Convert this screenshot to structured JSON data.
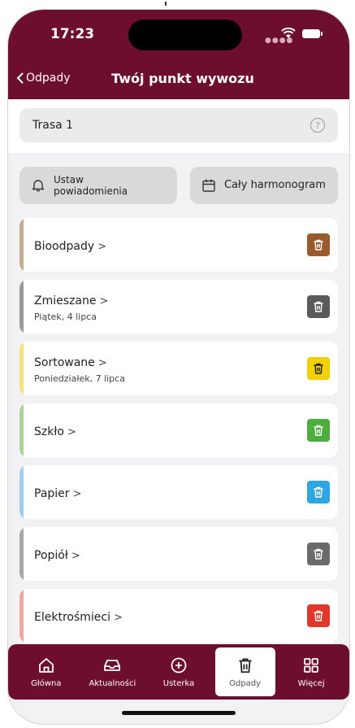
{
  "status": {
    "time": "17:23"
  },
  "nav": {
    "back_label": "Odpady",
    "title": "Twój punkt wywozu"
  },
  "route": {
    "label": "Trasa 1",
    "help": "?"
  },
  "actions": {
    "notify_label": "Ustaw powiadomienia",
    "schedule_label": "Cały harmonogram"
  },
  "waste_types": [
    {
      "name": "Bioodpady",
      "date": "",
      "color": "#c5ac8c",
      "bin_color": "#9b5a2e"
    },
    {
      "name": "Zmieszane",
      "date": "Piątek, 4 lipca",
      "color": "#9a9a9a",
      "bin_color": "#5a5a5c"
    },
    {
      "name": "Sortowane",
      "date": "Poniedziałek, 7 lipca",
      "color": "#f5e27a",
      "bin_color": "#f2cf00"
    },
    {
      "name": "Szkło",
      "date": "",
      "color": "#a9d698",
      "bin_color": "#4caf3c"
    },
    {
      "name": "Papier",
      "date": "",
      "color": "#9bcff0",
      "bin_color": "#2fa6e4"
    },
    {
      "name": "Popiół",
      "date": "",
      "color": "#a6a6a6",
      "bin_color": "#6b6b6d"
    },
    {
      "name": "Elektrośmieci",
      "date": "",
      "color": "#f0a69a",
      "bin_color": "#e0392b"
    }
  ],
  "tabs": [
    {
      "label": "Główna",
      "icon": "home-icon"
    },
    {
      "label": "Aktualności",
      "icon": "inbox-icon"
    },
    {
      "label": "Usterka",
      "icon": "plus-circle-icon"
    },
    {
      "label": "Odpady",
      "icon": "trash-icon",
      "active": true
    },
    {
      "label": "Więcej",
      "icon": "grid-icon"
    }
  ]
}
